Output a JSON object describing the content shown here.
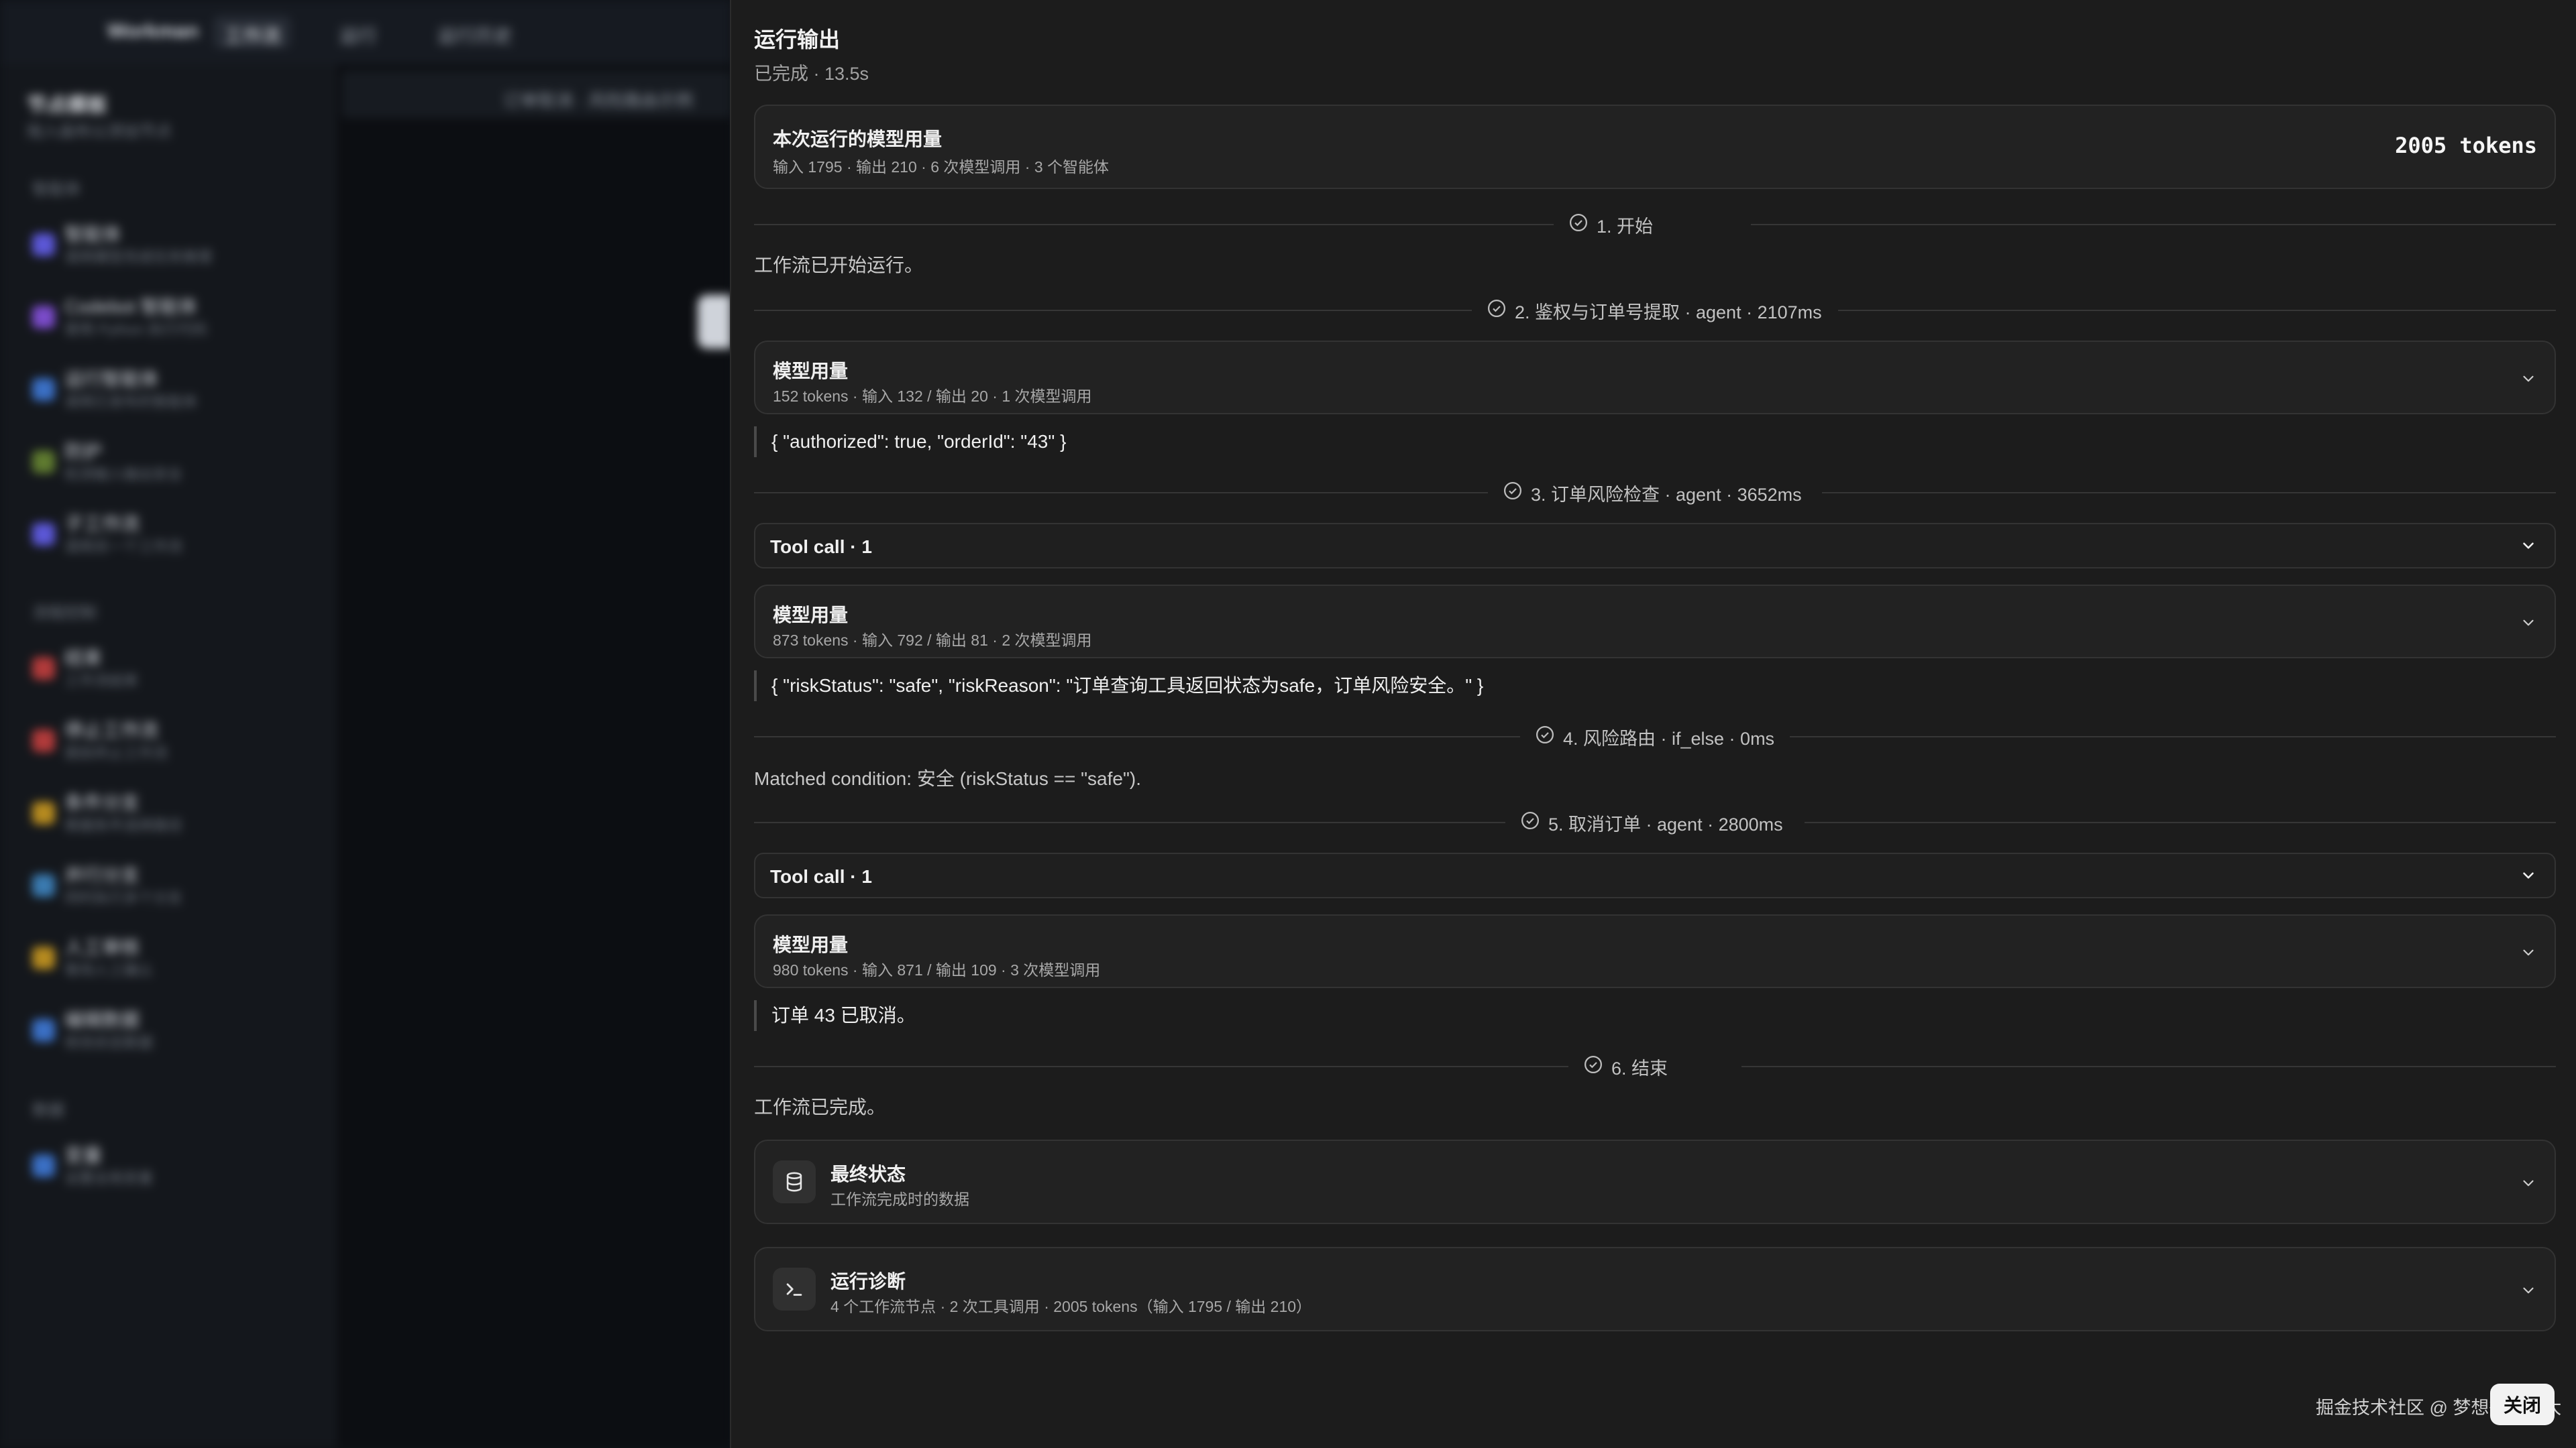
{
  "background": {
    "brand": "Workman",
    "nav": [
      {
        "label": "工作流"
      },
      {
        "label": "运行"
      },
      {
        "label": "运行历史"
      }
    ],
    "sidebar_title": "节点模板",
    "sidebar_subtitle": "拖入画布以添加节点",
    "section_1": "智能体",
    "section_2": "流程控制",
    "section_3": "数据",
    "items": [
      {
        "name": "智能体",
        "desc": "调用模型完成任务推理",
        "color": "#5b57d6"
      },
      {
        "name": "Codebot 智能体",
        "desc": "使用 Python 执行代码",
        "color": "#7a4bc9"
      },
      {
        "name": "运行智能体",
        "desc": "调用已发布的智能体",
        "color": "#3a6fc4"
      },
      {
        "name": "防护",
        "desc": "检测输入输出安全",
        "color": "#5e7a2f"
      },
      {
        "name": "子工作流",
        "desc": "调用另一个工作流",
        "color": "#5b57d6"
      },
      {
        "name": "结束",
        "desc": "工作流结束",
        "color": "#b03a3a"
      },
      {
        "name": "停止工作流",
        "desc": "提前终止工作流",
        "color": "#b03a3a"
      },
      {
        "name": "条件分支",
        "desc": "根据条件选择路径",
        "color": "#b58a1f"
      },
      {
        "name": "并行分支",
        "desc": "同时执行多个分支",
        "color": "#3a7ab0"
      },
      {
        "name": "人工审核",
        "desc": "等待人工确认",
        "color": "#b58a1f"
      },
      {
        "name": "编辑数据",
        "desc": "修改状态数据",
        "color": "#3a6fc4"
      },
      {
        "name": "变量",
        "desc": "设置全局变量",
        "color": "#3a6fc4"
      }
    ],
    "main_title": "订单取消 · 风险路由示例"
  },
  "drawer": {
    "title": "运行输出",
    "subtitle": "已完成 · 13.5s",
    "usage_card": {
      "title": "本次运行的模型用量",
      "meta": "输入 1795 · 输出 210 · 6 次模型调用 · 3 个智能体",
      "total": "2005 tokens"
    },
    "steps": [
      {
        "label": "1. 开始"
      },
      {
        "label": "2. 鉴权与订单号提取 · agent · 2107ms"
      },
      {
        "label": "3. 订单风险检查 · agent · 3652ms"
      },
      {
        "label": "4. 风险路由 · if_else · 0ms"
      },
      {
        "label": "5. 取消订单 · agent · 2800ms"
      },
      {
        "label": "6. 结束"
      }
    ],
    "start_text": "工作流已开始运行。",
    "step2_usage": {
      "title": "模型用量",
      "meta": "152 tokens · 输入 132 / 输出 20 · 1 次模型调用"
    },
    "step2_output": "{ \"authorized\": true, \"orderId\": \"43\" }",
    "step3_toolcall": "Tool call · 1",
    "step3_usage": {
      "title": "模型用量",
      "meta": "873 tokens · 输入 792 / 输出 81 · 2 次模型调用"
    },
    "step3_output": "{ \"riskStatus\": \"safe\", \"riskReason\": \"订单查询工具返回状态为safe，订单风险安全。\" }",
    "step4_text": "Matched condition: 安全 (riskStatus == \"safe\").",
    "step5_toolcall": "Tool call · 1",
    "step5_usage": {
      "title": "模型用量",
      "meta": "980 tokens · 输入 871 / 输出 109 · 3 次模型调用"
    },
    "step5_output": "订单 43 已取消。",
    "end_text": "工作流已完成。",
    "final_state": {
      "title": "最终状态",
      "meta": "工作流完成时的数据",
      "icon": "database-icon"
    },
    "diagnostics": {
      "title": "运行诊断",
      "meta": "4 个工作流节点 · 2 次工具调用 · 2005 tokens（输入 1795 / 输出 210）",
      "icon": "terminal-icon"
    },
    "close_label": "关闭",
    "watermark": "掘金技术社区 @ 梦想很大很大"
  }
}
